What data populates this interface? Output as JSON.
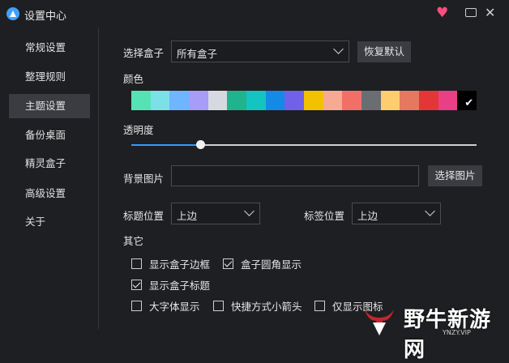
{
  "window": {
    "title": "设置中心"
  },
  "sidebar": {
    "items": [
      {
        "label": "常规设置"
      },
      {
        "label": "整理规则"
      },
      {
        "label": "主题设置",
        "active": true
      },
      {
        "label": "备份桌面"
      },
      {
        "label": "精灵盒子"
      },
      {
        "label": "高级设置"
      },
      {
        "label": "关于"
      }
    ]
  },
  "main": {
    "select_box_label": "选择盒子",
    "select_box_value": "所有盒子",
    "restore_default": "恢复默认",
    "color_label": "颜色",
    "colors": [
      "#56e3b3",
      "#7ce0e8",
      "#6fb5ff",
      "#a79cf7",
      "#d6dae0",
      "#1fb48d",
      "#14c4c0",
      "#1589e6",
      "#7061e8",
      "#f2c200",
      "#f6aa94",
      "#f26f68",
      "#6a6e73",
      "#ffcd6e",
      "#e5785f",
      "#e53637",
      "#e83f86",
      "#000000"
    ],
    "selected_color_index": 17,
    "opacity_label": "透明度",
    "opacity_value": 0.2,
    "bg_image_label": "背景图片",
    "bg_image_value": "",
    "choose_image": "选择图片",
    "title_pos_label": "标题位置",
    "title_pos_value": "上边",
    "tag_pos_label": "标签位置",
    "tag_pos_value": "上边",
    "other_label": "其它",
    "checkboxes": [
      {
        "label": "显示盒子边框",
        "checked": false
      },
      {
        "label": "盒子圆角显示",
        "checked": true
      },
      {
        "label": "显示盒子标题",
        "checked": true
      },
      {
        "label": "大字体显示",
        "checked": false
      },
      {
        "label": "快捷方式小箭头",
        "checked": false
      },
      {
        "label": "仅显示图标",
        "checked": false
      }
    ]
  },
  "watermark": {
    "text": "野牛新游网",
    "sub": "YNZY.VIP"
  }
}
